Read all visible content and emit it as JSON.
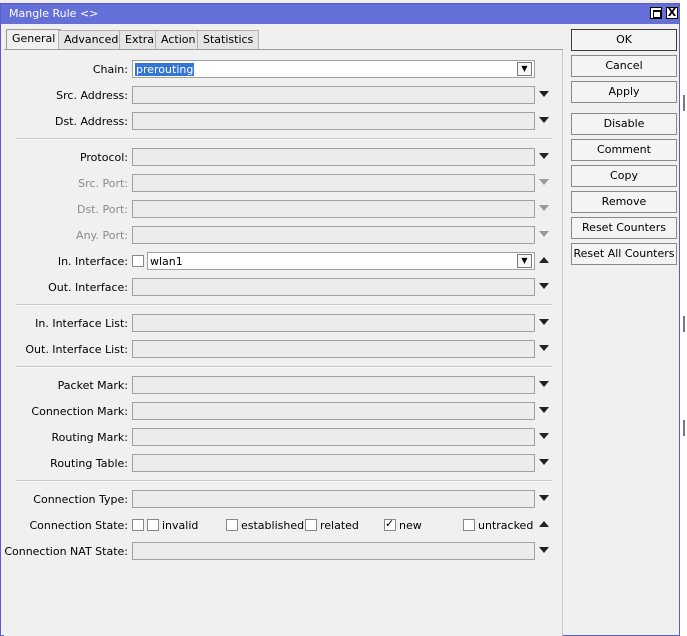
{
  "window": {
    "title": "Mangle Rule <>"
  },
  "tabs": [
    "General",
    "Advanced",
    "Extra",
    "Action",
    "Statistics"
  ],
  "fields": {
    "chain": {
      "label": "Chain:",
      "value": "prerouting"
    },
    "src_address": {
      "label": "Src. Address:"
    },
    "dst_address": {
      "label": "Dst. Address:"
    },
    "protocol": {
      "label": "Protocol:"
    },
    "src_port": {
      "label": "Src. Port:"
    },
    "dst_port": {
      "label": "Dst. Port:"
    },
    "any_port": {
      "label": "Any. Port:"
    },
    "in_interface": {
      "label": "In. Interface:",
      "value": "wlan1"
    },
    "out_interface": {
      "label": "Out. Interface:"
    },
    "in_interface_list": {
      "label": "In. Interface List:"
    },
    "out_interface_list": {
      "label": "Out. Interface List:"
    },
    "packet_mark": {
      "label": "Packet Mark:"
    },
    "connection_mark": {
      "label": "Connection Mark:"
    },
    "routing_mark": {
      "label": "Routing Mark:"
    },
    "routing_table": {
      "label": "Routing Table:"
    },
    "connection_type": {
      "label": "Connection Type:"
    },
    "connection_state": {
      "label": "Connection State:",
      "options": [
        {
          "label": "invalid",
          "checked": false
        },
        {
          "label": "established",
          "checked": false
        },
        {
          "label": "related",
          "checked": false
        },
        {
          "label": "new",
          "checked": true
        },
        {
          "label": "untracked",
          "checked": false
        }
      ]
    },
    "connection_nat_state": {
      "label": "Connection NAT State:"
    }
  },
  "buttons": {
    "ok": "OK",
    "cancel": "Cancel",
    "apply": "Apply",
    "disable": "Disable",
    "comment": "Comment",
    "copy": "Copy",
    "remove": "Remove",
    "reset_counters": "Reset Counters",
    "reset_all_counters": "Reset All Counters"
  },
  "icons": {
    "maximize": "maximize-icon",
    "close": "close-icon",
    "close_glyph": "X"
  }
}
